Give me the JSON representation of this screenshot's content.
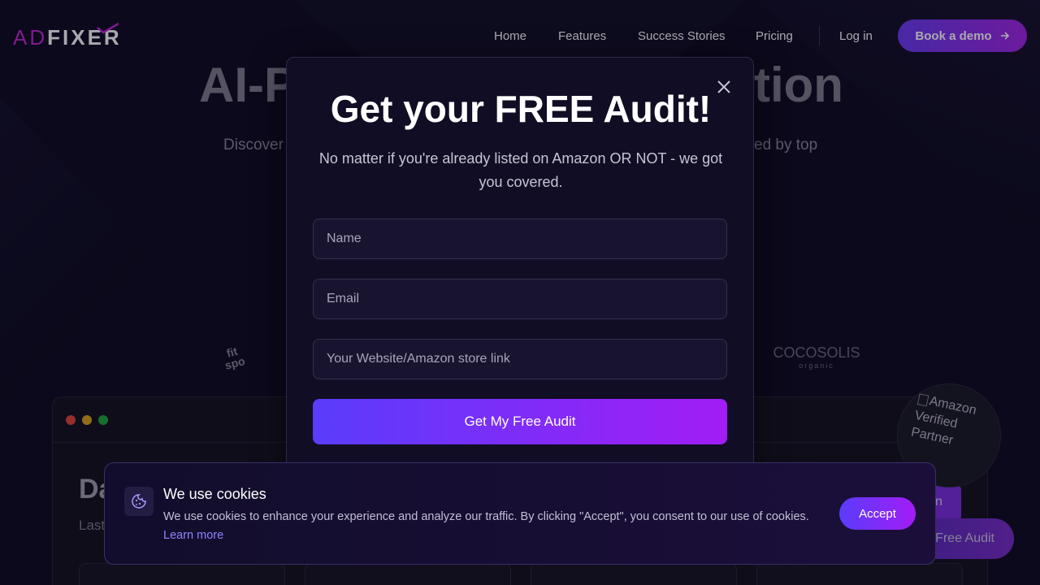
{
  "brand": {
    "logo_ad": "AD",
    "logo_fixer": "FIXER"
  },
  "nav": {
    "items": [
      {
        "label": "Home"
      },
      {
        "label": "Features"
      },
      {
        "label": "Success Stories"
      },
      {
        "label": "Pricing"
      }
    ],
    "login_label": "Log in",
    "demo_label": "Book a demo",
    "demo_icon": "arrow-right-icon"
  },
  "hero": {
    "title_left": "AI-P",
    "title_right": "tion",
    "subtitle_left": "Discover",
    "subtitle_right": "ed by top"
  },
  "logos": {
    "fitspo": "fit spo",
    "cocosolis": "COCOSOLIS",
    "cocosolis_sub": "organic"
  },
  "dashboard": {
    "title_fragment": "Da",
    "subtitle_fragment": "Last",
    "button_fragment": "n"
  },
  "badge": {
    "alt_text": "Amazon Verified Partner"
  },
  "floating_button": {
    "label": "Free Audit"
  },
  "modal": {
    "title": "Get your FREE Audit!",
    "description": "No matter if you're already listed on Amazon OR NOT - we got you covered.",
    "fields": {
      "name_placeholder": "Name",
      "email_placeholder": "Email",
      "website_placeholder": "Your Website/Amazon store link"
    },
    "submit_label": "Get My Free Audit",
    "close_icon": "close-icon"
  },
  "cookie": {
    "title": "We use cookies",
    "text": "We use cookies to enhance your experience and analyze our traffic. By clicking \"Accept\", you consent to our use of cookies.",
    "link_label": "Learn more",
    "accept_label": "Accept",
    "icon": "cookie-icon"
  },
  "colors": {
    "background": "#0d0b1f",
    "accent_start": "#5a3cfb",
    "accent_end": "#a21df5",
    "brand_magenta": "#c026d3",
    "link": "#8f84ff"
  }
}
